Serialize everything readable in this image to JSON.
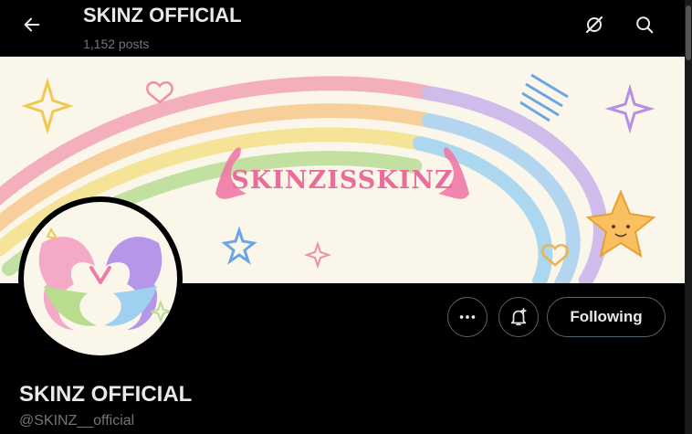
{
  "header": {
    "title": "SKINZ OFFICIAL",
    "post_count": "1,152 posts",
    "back_icon": "arrow-left-icon",
    "grok_icon": "grok-icon",
    "search_icon": "search-icon"
  },
  "banner": {
    "logo_text": "SKINZISSKINZ"
  },
  "actions": {
    "more_icon": "more-horizontal-icon",
    "notify_icon": "bell-plus-icon",
    "follow_label": "Following"
  },
  "profile": {
    "display_name": "SKINZ OFFICIAL",
    "handle": "@SKINZ__official"
  },
  "colors": {
    "background": "#000000",
    "text_primary": "#e7e9ea",
    "text_secondary": "#71767b",
    "border": "#536471",
    "banner_bg": "#fbf6ea"
  }
}
